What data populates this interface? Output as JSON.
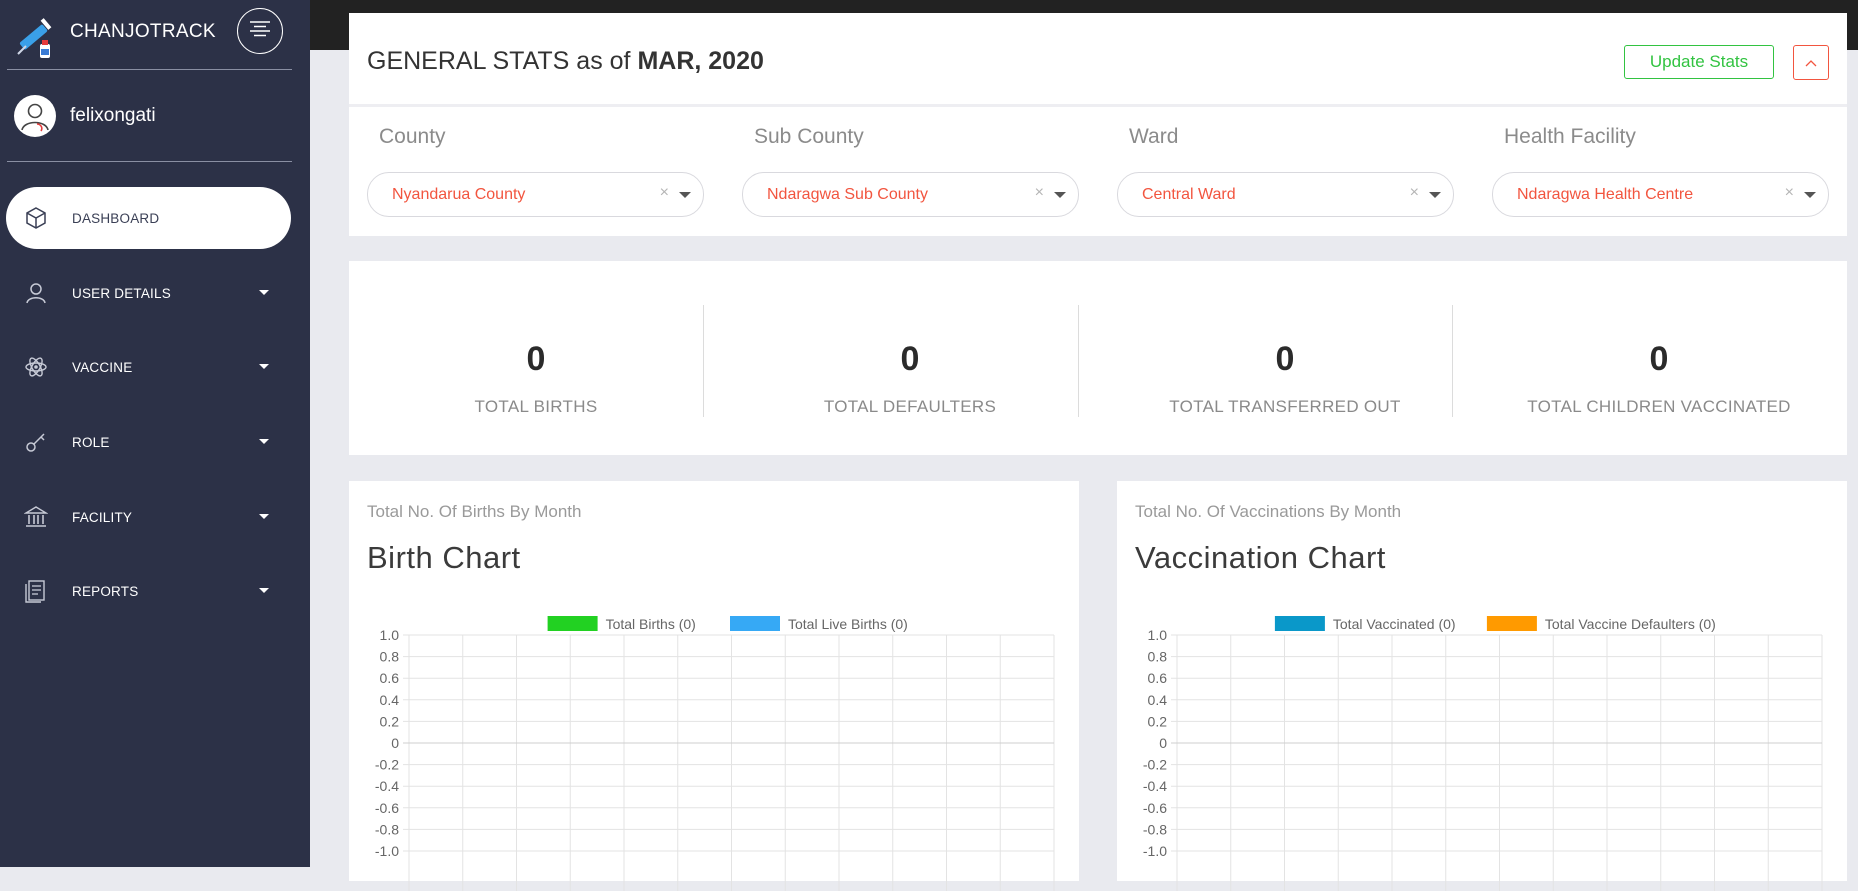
{
  "sidebar": {
    "brand": "CHANJOTRACK",
    "username": "felixongati",
    "items": [
      {
        "label": "DASHBOARD",
        "icon": "cube-icon",
        "active": true
      },
      {
        "label": "USER DETAILS",
        "icon": "user-icon"
      },
      {
        "label": "VACCINE",
        "icon": "atom-icon"
      },
      {
        "label": "ROLE",
        "icon": "key-icon"
      },
      {
        "label": "FACILITY",
        "icon": "bank-icon"
      },
      {
        "label": "REPORTS",
        "icon": "document-icon"
      }
    ]
  },
  "header": {
    "title_prefix": "GENERAL STATS as of ",
    "title_date": "MAR, 2020",
    "update_label": "Update Stats"
  },
  "filters": [
    {
      "label": "County",
      "value": "Nyandarua County"
    },
    {
      "label": "Sub County",
      "value": "Ndaragwa Sub County"
    },
    {
      "label": "Ward",
      "value": "Central Ward"
    },
    {
      "label": "Health Facility",
      "value": "Ndaragwa Health Centre"
    }
  ],
  "stats": [
    {
      "value": "0",
      "label": "TOTAL BIRTHS"
    },
    {
      "value": "0",
      "label": "TOTAL DEFAULTERS"
    },
    {
      "value": "0",
      "label": "TOTAL TRANSFERRED OUT"
    },
    {
      "value": "0",
      "label": "TOTAL CHILDREN VACCINATED"
    }
  ],
  "colors": {
    "accent_red": "#f2553f",
    "accent_green": "#32c341",
    "sidebar_bg": "#2c3147"
  },
  "charts": [
    {
      "subtitle": "Total No. Of Births By Month",
      "title": "Birth Chart"
    },
    {
      "subtitle": "Total No. Of Vaccinations By Month",
      "title": "Vaccination Chart"
    }
  ],
  "chart_data": [
    {
      "type": "bar",
      "title": "Birth Chart",
      "series": [
        {
          "name": "Total Births (0)",
          "color": "#22d122",
          "values": []
        },
        {
          "name": "Total Live Births (0)",
          "color": "#36a9f5",
          "values": []
        }
      ],
      "ylim": [
        -1.0,
        1.0
      ],
      "yticks": [
        "1.0",
        "0.8",
        "0.6",
        "0.4",
        "0.2",
        "0",
        "-0.2",
        "-0.4",
        "-0.6",
        "-0.8",
        "-1.0"
      ],
      "grid": true,
      "legend": "top-center"
    },
    {
      "type": "bar",
      "title": "Vaccination Chart",
      "series": [
        {
          "name": "Total Vaccinated (0)",
          "color": "#0a98c9",
          "values": []
        },
        {
          "name": "Total Vaccine Defaulters (0)",
          "color": "#ff9a00",
          "values": []
        }
      ],
      "ylim": [
        -1.0,
        1.0
      ],
      "yticks": [
        "1.0",
        "0.8",
        "0.6",
        "0.4",
        "0.2",
        "0",
        "-0.2",
        "-0.4",
        "-0.6",
        "-0.8",
        "-1.0"
      ],
      "grid": true,
      "legend": "top-center"
    }
  ]
}
